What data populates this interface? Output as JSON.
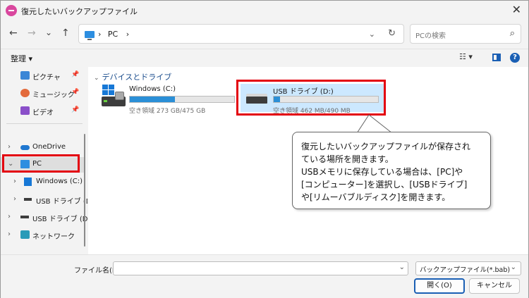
{
  "window": {
    "title": "復元したいバックアップファイル",
    "close_icon": "close-icon"
  },
  "nav": {
    "back": "←",
    "forward": "→",
    "recent": "⌄",
    "up": "↑",
    "address": "PC",
    "address_chevron": "›",
    "search_placeholder": "PCの検索"
  },
  "toolbar": {
    "organize_label": "整理 ▾",
    "view_label": "☷ ▾"
  },
  "sidebar": {
    "items": [
      {
        "label": "ピクチャ",
        "pinned": true
      },
      {
        "label": "ミュージック",
        "pinned": true
      },
      {
        "label": "ビデオ",
        "pinned": true
      },
      {
        "label": "OneDrive"
      },
      {
        "label": "PC",
        "selected": true
      },
      {
        "label": "Windows (C:)"
      },
      {
        "label": "USB ドライブ (D:"
      },
      {
        "label": "USB ドライブ (D:)"
      },
      {
        "label": "ネットワーク"
      }
    ]
  },
  "main": {
    "group_title": "デバイスとドライブ",
    "drives": [
      {
        "name": "Windows (C:)",
        "info": "空き領域 273 GB/475 GB",
        "used_fraction": 0.43
      },
      {
        "name": "USB ドライブ (D:)",
        "info": "空き領域 462 MB/490 MB",
        "used_fraction": 0.06
      }
    ]
  },
  "callout": {
    "lines": [
      "復元したいバックアップファイルが保存され",
      "ている場所を開きます。",
      "USBメモリに保存している場合は、[PC]や",
      "[コンピューター]を選択し、[USBドライブ]",
      "や[リムーバブルディスク]を開きます。"
    ]
  },
  "footer": {
    "filename_label": "ファイル名(N):",
    "filename_value": "",
    "filetype_value": "バックアップファイル(*.bab)",
    "open_label": "開く(O)",
    "cancel_label": "キャンセル"
  },
  "colors": {
    "accent": "#1a5fb4",
    "highlight": "#e3000f",
    "bar_fill": "#2b8fd7",
    "selection": "#cce8ff"
  }
}
